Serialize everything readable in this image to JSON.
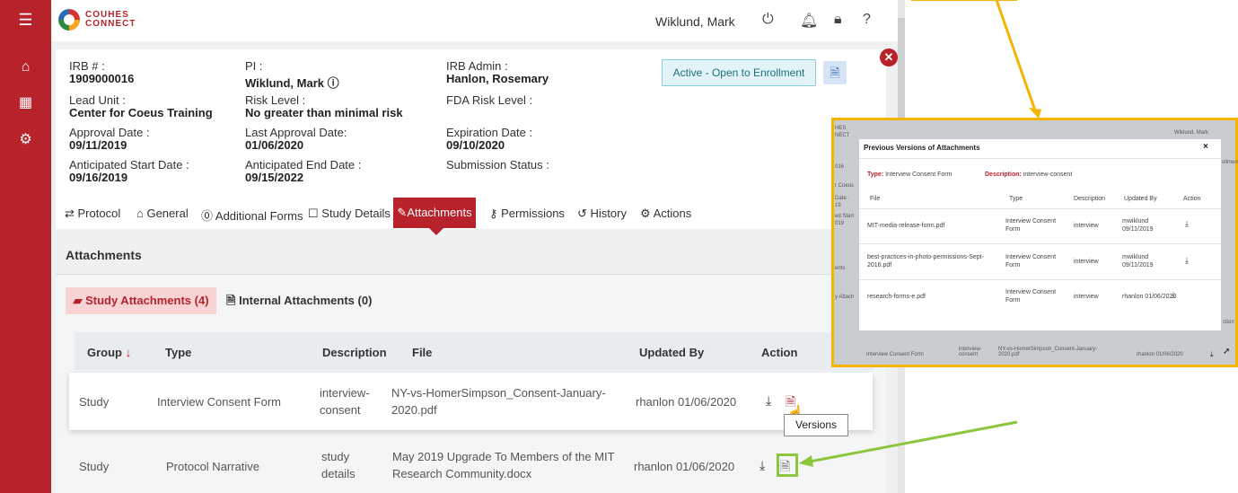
{
  "app": {
    "logo_line1": "COUHES",
    "logo_line2": "CONNECT",
    "user": "Wiklund, Mark"
  },
  "protocol": {
    "irb_label": "IRB # :",
    "irb_value": "1909000016",
    "pi_label": "PI :",
    "pi_value": "Wiklund, Mark",
    "irb_admin_label": "IRB Admin :",
    "irb_admin_value": "Hanlon, Rosemary",
    "lead_unit_label": "Lead Unit :",
    "lead_unit_value": "Center for Coeus Training",
    "risk_label": "Risk Level :",
    "risk_value": "No greater than minimal risk",
    "fda_label": "FDA Risk Level :",
    "approval_label": "Approval Date :",
    "approval_value": "09/11/2019",
    "last_approval_label": "Last Approval Date:",
    "last_approval_value": "01/06/2020",
    "expiration_label": "Expiration Date :",
    "expiration_value": "09/10/2020",
    "ant_start_label": "Anticipated Start Date :",
    "ant_start_value": "09/16/2019",
    "ant_end_label": "Anticipated End Date :",
    "ant_end_value": "09/15/2022",
    "submission_label": "Submission Status :",
    "status": "Active - Open to Enrollment"
  },
  "tabs": [
    "Protocol",
    "General",
    "Additional Forms",
    "Study Details",
    "Attachments",
    "Permissions",
    "History",
    "Actions"
  ],
  "attachments": {
    "title": "Attachments",
    "subtab_study": "Study Attachments (4)",
    "subtab_internal": "Internal Attachments (0)",
    "columns": [
      "Group",
      "Type",
      "Description",
      "File",
      "Updated By",
      "Action"
    ],
    "rows": [
      {
        "group": "Study",
        "type": "Interview Consent Form",
        "desc1": "interview-",
        "desc2": "consent",
        "file1": "NY-vs-HomerSimpson_Consent-January-",
        "file2": "2020.pdf",
        "updated": "rhanlon 01/06/2020"
      },
      {
        "group": "Study",
        "type": "Protocol Narrative",
        "desc1": "study",
        "desc2": "details",
        "file1": "May 2019 Upgrade To Members of the MIT",
        "file2": "Research Community.docx",
        "updated": "rhanlon 01/06/2020"
      }
    ],
    "tooltip": "Versions"
  },
  "popup": {
    "title": "Previous Versions of Attachments",
    "type_label": "Type:",
    "type_value": "Interview Consent Form",
    "desc_label": "Description:",
    "desc_value": "interview-consent",
    "columns": [
      "File",
      "Type",
      "Description",
      "Updated By",
      "Action"
    ],
    "rows": [
      {
        "file1": "MIT-media-release-form.pdf",
        "file2": "",
        "type1": "Interview Consent",
        "type2": "Form",
        "desc": "interview",
        "upd1": "mwiklund",
        "upd2": "09/11/2019"
      },
      {
        "file1": "best-practices-in-photo-permissions-Sept-",
        "file2": "2016.pdf",
        "type1": "Interview Consent",
        "type2": "Form",
        "desc": "interview",
        "upd1": "mwiklund",
        "upd2": "09/11/2019"
      },
      {
        "file1": "research-forms-e.pdf",
        "file2": "",
        "type1": "Interview Consent",
        "type2": "Form",
        "desc": "interview",
        "upd1": "rhanlon 01/06/2020",
        "upd2": ""
      }
    ],
    "bg_user": "Wiklund, Mark",
    "bg_row_type": "Interview Consent Form",
    "bg_row_desc1": "interview-",
    "bg_row_desc2": "consent",
    "bg_row_file1": "NY-vs-HomerSimpson_Consent-January-",
    "bg_row_file2": "2020.pdf",
    "bg_row_upd": "rhanlon 01/06/2020",
    "bg_fragments": [
      "016",
      "r Coeus",
      "Date :",
      "19",
      "ed Start",
      "019",
      "ents",
      "y Attach",
      "ction",
      "ollment",
      "HES",
      "NECT"
    ]
  },
  "colors": {
    "brand_red": "#b8232b",
    "highlight_yellow": "#f5b400",
    "annotation_green": "#8cc63f"
  }
}
